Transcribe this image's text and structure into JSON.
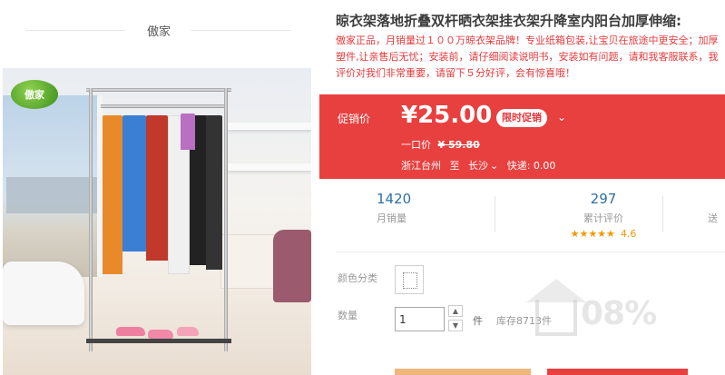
{
  "brand": {
    "name": "傲家",
    "logo_text": "傲家"
  },
  "product": {
    "title": "晾衣架落地折叠双杆晒衣架挂衣架升降室内阳台加厚伸缩:",
    "subtitle": "傲家正品，月销量过１００万晾衣架品牌！专业纸箱包装,让宝贝在旅途中更安全；加厚塑件,让亲售后无忧；安装前，请仔细阅读说明书，安装如有问题，请和我客服联系，我评价对我们非常重要，请留下５分好评，会有惊喜哦！"
  },
  "price": {
    "promo_label": "促销价",
    "current": "¥25.00",
    "promo_tag": "限时促销",
    "original_label": "一口价",
    "original_value": "¥ 59.80",
    "ship_from": "浙江台州",
    "ship_to_label": "至",
    "ship_to": "长沙",
    "express": "快递: 0.00"
  },
  "stats": {
    "monthly_sales": "1420",
    "monthly_sales_label": "月销量",
    "reviews": "297",
    "reviews_label": "累计评价",
    "stars": "★★★★★",
    "rating": "4.6",
    "third_label": "送"
  },
  "options": {
    "color_label": "颜色分类",
    "qty_label": "数量",
    "qty_value": "1",
    "unit": "件",
    "stock": "库存8713件"
  },
  "watermark": {
    "text": "08%"
  },
  "colors": {
    "accent": "#e8403f",
    "link": "#2d6ea6",
    "star": "#f39800"
  }
}
